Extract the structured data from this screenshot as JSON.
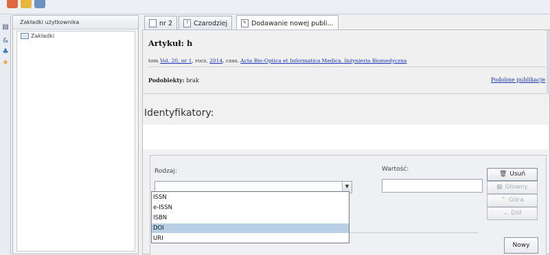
{
  "sidebar": {
    "panel_title": "Zakładki użytkownika",
    "tree_root": "Zakładki"
  },
  "tabs": [
    {
      "label": "nr 2",
      "icon": "document-icon"
    },
    {
      "label": "Czarodziej",
      "icon": "wizard-icon"
    },
    {
      "label": "Dodawanie nowej publi...",
      "icon": "edit-document-icon"
    }
  ],
  "article": {
    "title": "Artykuł: h",
    "tom_prefix": "tom",
    "volume_link": "Vol. 20, nr 1",
    "rocz_prefix": ", rocz.",
    "year_link": "2014",
    "czas_prefix": ", czas.",
    "journal_link": "Acta Bio-Optica et Informatica Medica. Inżynieria Biomedyczna",
    "podobiekty_label": "Podobiekty:",
    "podobiekty_value": "brak",
    "similar_link": "Podobne publikacje"
  },
  "identifiers": {
    "section_title": "Identyfikatory:",
    "type_label": "Rodzaj:",
    "value_label": "Wartość:",
    "type_value": "",
    "value_value": "",
    "type_options": [
      "ISSN",
      "e-ISSN",
      "ISBN",
      "DOI",
      "URI"
    ],
    "selected_option": "DOI",
    "buttons": {
      "delete": "Usuń",
      "main": "Główny",
      "up": "Góra",
      "down": "Dół",
      "new": "Nowy"
    }
  },
  "colors": {
    "link": "#1a35b8",
    "selection": "#b8cfe5"
  }
}
